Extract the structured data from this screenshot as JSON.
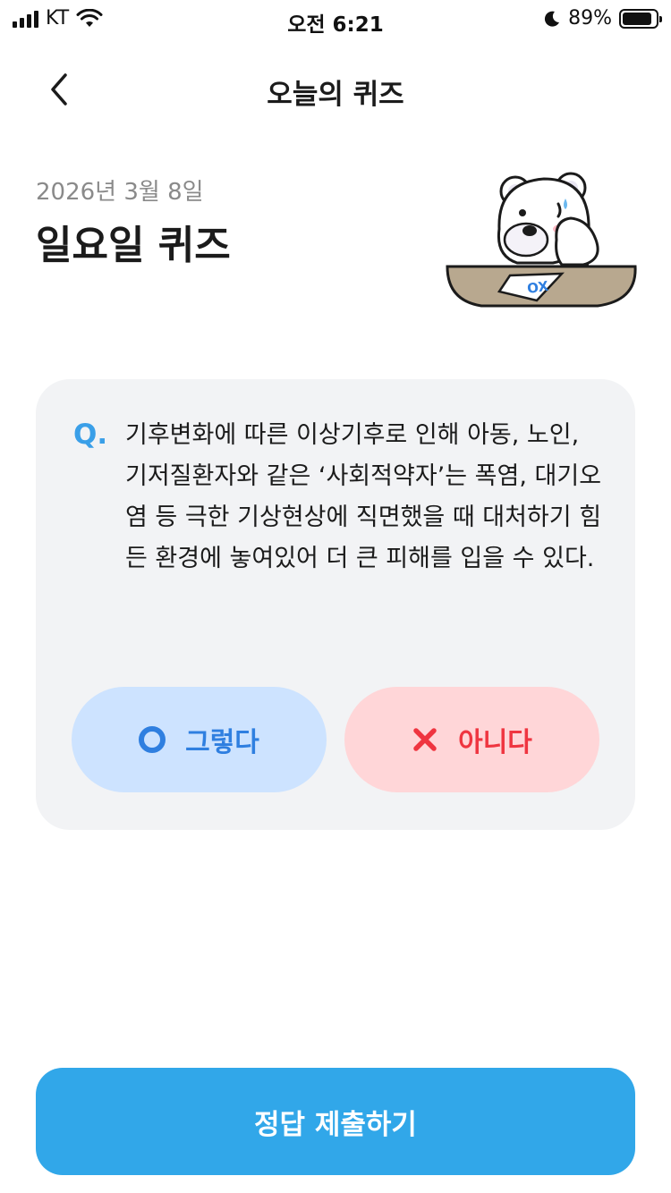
{
  "status_bar": {
    "carrier": "KT",
    "time": "오전 6:21",
    "battery_percent": "89%",
    "battery_level": 0.89
  },
  "header": {
    "title": "오늘의 퀴즈",
    "back_icon": "chevron-left-icon"
  },
  "quiz": {
    "date": "2026년 3월 8일",
    "title": "일요일 퀴즈",
    "question_label": "Q.",
    "question": "기후변화에 따른 이상기후로 인해 아동, 노인, 기저질환자와 같은 ‘사회적약자’는 폭염, 대기오염 등 극한 기상현상에 직면했을 때 대처하기 힘든 환경에 놓여있어 더 큰 피해를 입을 수 있다.",
    "mascot_icon": "bear-mascot-ox-icon",
    "mascot_paper_text": "OX"
  },
  "answers": {
    "yes_label": "그렇다",
    "yes_icon": "circle-o-icon",
    "no_label": "아니다",
    "no_icon": "x-mark-icon"
  },
  "submit": {
    "label": "정답 제출하기"
  },
  "colors": {
    "accent": "#31a7e9",
    "yes_bg": "#cde3ff",
    "yes_fg": "#2f7fe0",
    "no_bg": "#ffd6d8",
    "no_fg": "#ef3540",
    "card_bg": "#f2f3f5"
  }
}
